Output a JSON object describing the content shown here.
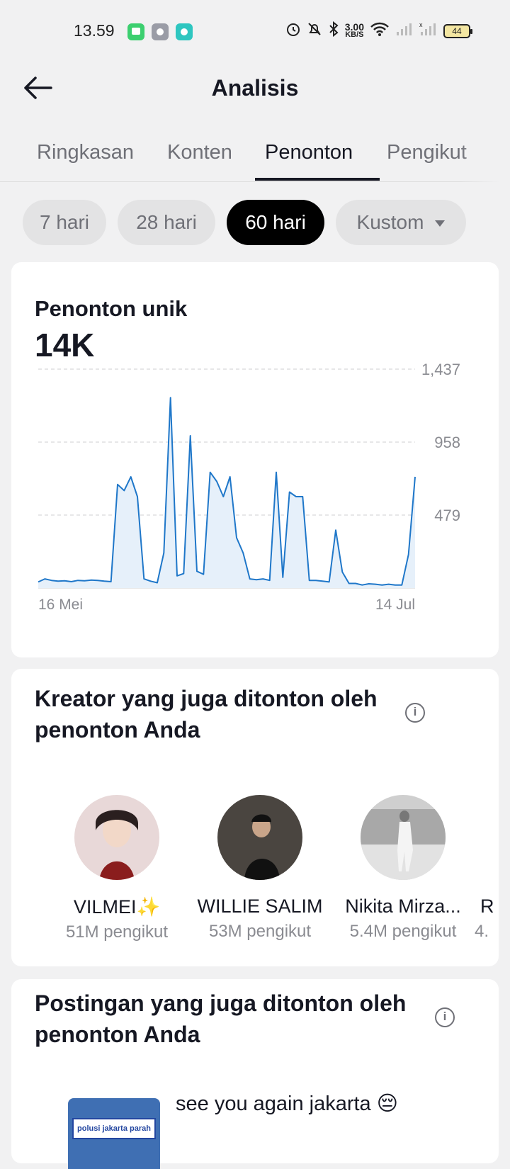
{
  "status_bar": {
    "time": "13.59",
    "speed_value": "3.00",
    "speed_unit": "KB/S",
    "battery": "44"
  },
  "header": {
    "title": "Analisis"
  },
  "tabs": [
    {
      "label": "Ringkasan",
      "active": false
    },
    {
      "label": "Konten",
      "active": false
    },
    {
      "label": "Penonton",
      "active": true
    },
    {
      "label": "Pengikut",
      "active": false
    }
  ],
  "ranges": [
    {
      "label": "7 hari",
      "active": false
    },
    {
      "label": "28 hari",
      "active": false
    },
    {
      "label": "60 hari",
      "active": true
    },
    {
      "label": "Kustom",
      "active": false
    }
  ],
  "unique_viewers": {
    "label": "Penonton unik",
    "value": "14K"
  },
  "chart_data": {
    "type": "area",
    "title": "Penonton unik",
    "x_start_label": "16 Mei",
    "x_end_label": "14 Jul",
    "yticks": [
      "1,437",
      "958",
      "479"
    ],
    "ylim": [
      0,
      1437
    ],
    "grid": true,
    "line_color": "#1f77c9",
    "values": [
      40,
      60,
      50,
      45,
      48,
      42,
      50,
      48,
      52,
      50,
      45,
      42,
      680,
      640,
      730,
      600,
      60,
      45,
      35,
      230,
      1250,
      80,
      95,
      1000,
      110,
      90,
      760,
      700,
      600,
      730,
      330,
      230,
      60,
      55,
      60,
      50,
      760,
      70,
      630,
      600,
      600,
      50,
      50,
      45,
      40,
      380,
      105,
      30,
      30,
      20,
      28,
      25,
      20,
      25,
      20,
      20,
      220,
      730
    ]
  },
  "creators_section": {
    "title": "Kreator yang juga ditonton oleh penonton Anda",
    "creators": [
      {
        "name": "VILMEI✨",
        "followers": "51M pengikut"
      },
      {
        "name": "WILLIE SALIM",
        "followers": "53M pengikut"
      },
      {
        "name": "Nikita Mirza...",
        "followers": "5.4M pengikut"
      },
      {
        "name": "R",
        "followers": "4."
      }
    ]
  },
  "posts_section": {
    "title": "Postingan yang juga ditonton oleh penonton Anda",
    "posts": [
      {
        "thumb_text": "polusi jakarta parah",
        "caption": "see you again jakarta 😔"
      }
    ]
  },
  "colors": {
    "accent": "#000000",
    "chart_line": "#1f77c9",
    "chart_fill": "#e6f0fa",
    "background": "#f1f1f2"
  }
}
